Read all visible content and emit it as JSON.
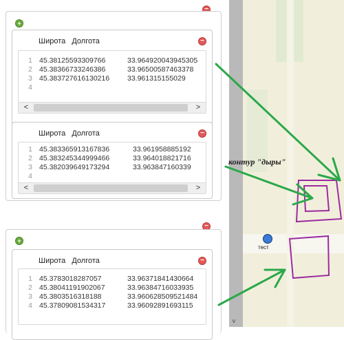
{
  "colors": {
    "plus": "#6aaa3c",
    "minus": "#e25a5a",
    "arrow": "#2aa84a",
    "polygon": "#9b2b9f",
    "map_bg": "#f1efdb",
    "map_field": "#e1ead0",
    "scroll_bar": "#b9b9b9"
  },
  "icons": {
    "add": "plus-circle-icon",
    "remove": "minus-circle-icon",
    "scroll_left": "chevron-left-icon",
    "scroll_right": "chevron-right-icon",
    "scroll_down": "chevron-down-icon",
    "marker": "location-dot-icon"
  },
  "glyphs": {
    "plus": "+",
    "minus": "−",
    "left": "<",
    "right": ">",
    "down": "˅"
  },
  "panels": [
    {
      "polygons": [
        {
          "headers": [
            "Широта",
            "Долгота"
          ],
          "rows": [
            {
              "n": "1",
              "lat": "45.38125593309766",
              "lng": "33.964920043945305"
            },
            {
              "n": "2",
              "lat": "45.38366733246386",
              "lng": "33.96500587463378"
            },
            {
              "n": "3",
              "lat": "45.383727616130216",
              "lng": "33.961315155029"
            },
            {
              "n": "4",
              "lat": "",
              "lng": ""
            }
          ]
        },
        {
          "headers": [
            "Широта",
            "Долгота"
          ],
          "rows": [
            {
              "n": "1",
              "lat": "45.383365913167836",
              "lng": "33.961958885192"
            },
            {
              "n": "2",
              "lat": "45.383245344999466",
              "lng": "33.964018821716"
            },
            {
              "n": "3",
              "lat": "45.382039649173294",
              "lng": "33.963847160339"
            },
            {
              "n": "4",
              "lat": "",
              "lng": ""
            }
          ]
        }
      ]
    },
    {
      "polygons": [
        {
          "headers": [
            "Широта",
            "Долгота"
          ],
          "rows": [
            {
              "n": "1",
              "lat": "45.3783018287057",
              "lng": "33.96371841430664"
            },
            {
              "n": "2",
              "lat": "45.38041191902067",
              "lng": "33.96384716033935"
            },
            {
              "n": "3",
              "lat": "45.3803516318188",
              "lng": "33.960628509521484"
            },
            {
              "n": "4",
              "lat": "45.37809081534317",
              "lng": "33.96092891693115"
            }
          ]
        }
      ]
    }
  ],
  "map": {
    "marker_label": "тест"
  },
  "annotation": "контур \"дыры\""
}
